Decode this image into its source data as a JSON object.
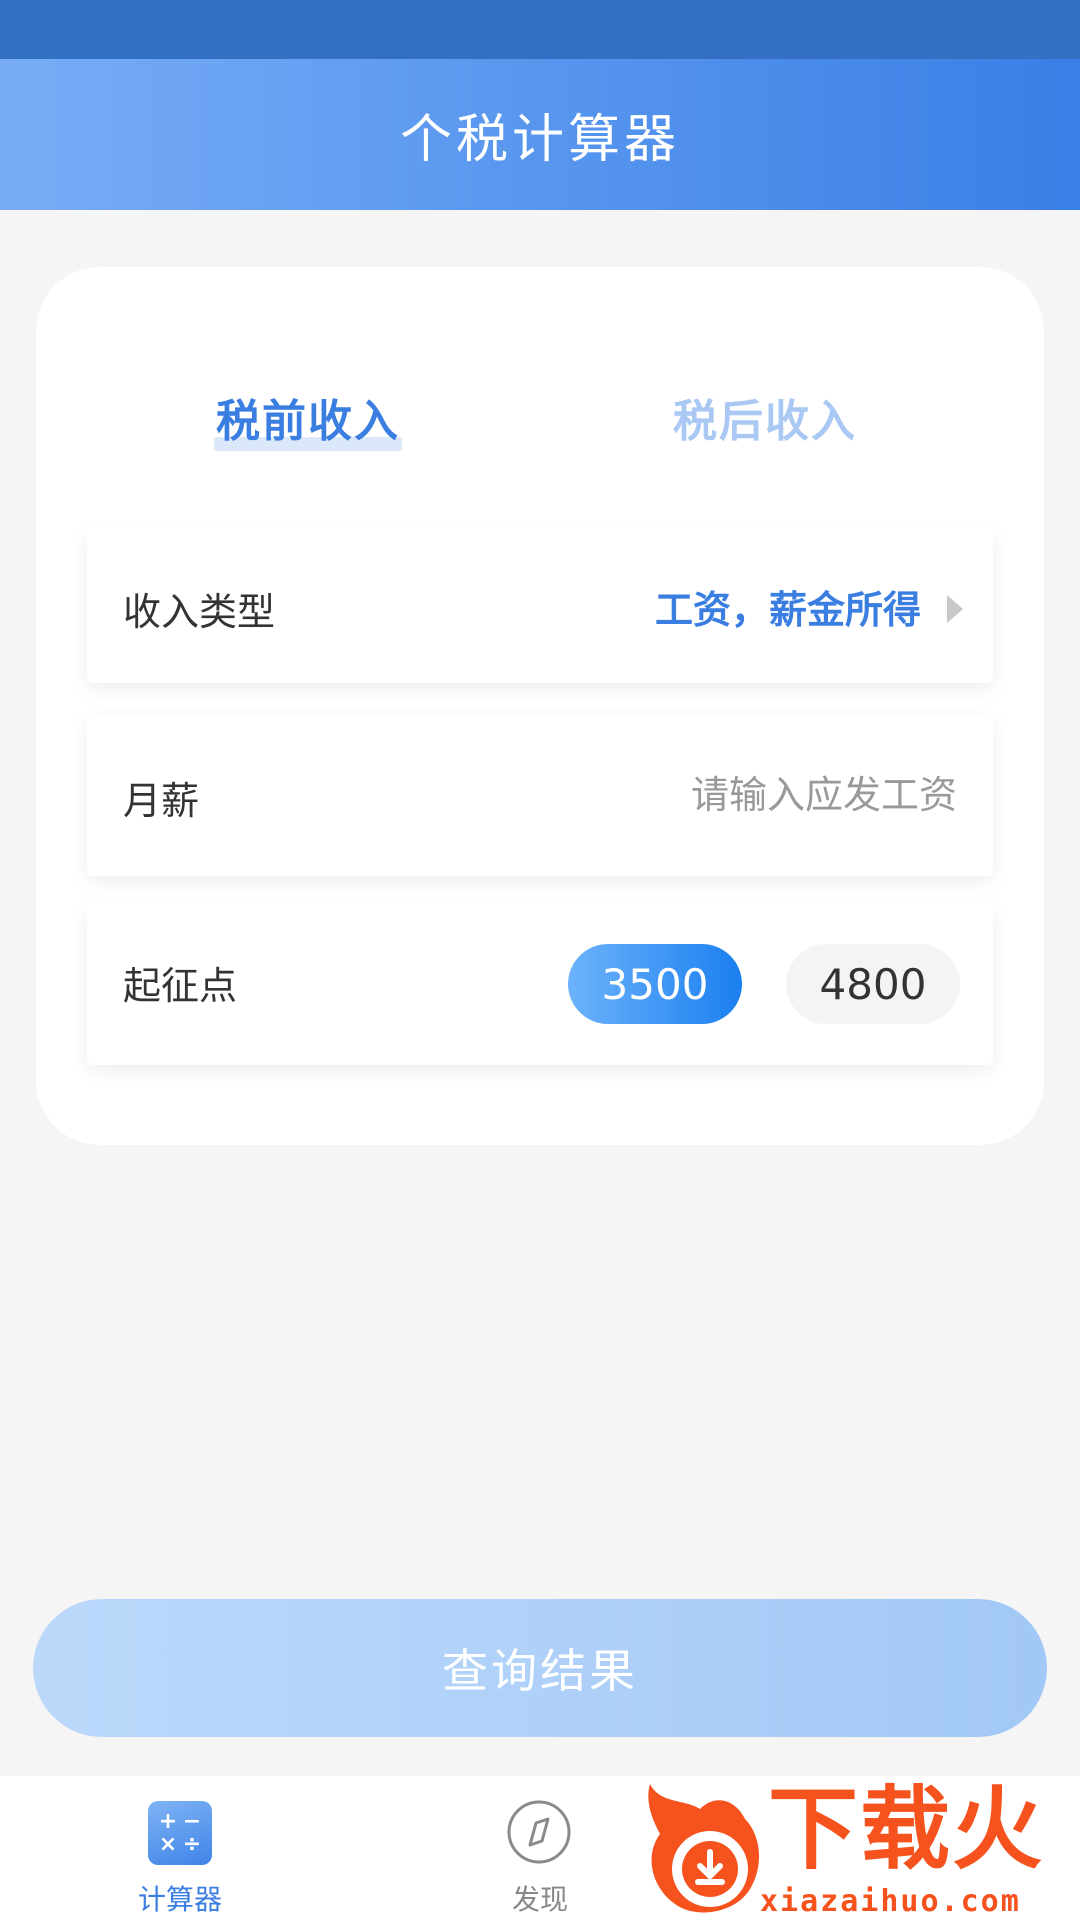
{
  "header": {
    "title": "个税计算器"
  },
  "tabs": {
    "pre_tax": "税前收入",
    "post_tax": "税后收入"
  },
  "form": {
    "income_type_label": "收入类型",
    "income_type_value": "工资，薪金所得",
    "salary_label": "月薪",
    "salary_placeholder": "请输入应发工资",
    "salary_value": "",
    "threshold_label": "起征点",
    "threshold_options": [
      "3500",
      "4800"
    ],
    "threshold_selected": "3500"
  },
  "query_button": {
    "label": "查询结果"
  },
  "bottom_nav": {
    "items": [
      {
        "label": "计算器",
        "icon": "calculator-icon",
        "active": true
      },
      {
        "label": "发现",
        "icon": "compass-icon",
        "active": false
      }
    ]
  },
  "watermark": {
    "name": "下载火",
    "site": "xiazaihuo.com"
  },
  "colors": {
    "accent": "#3a7ee1",
    "status_bar": "#3370c4",
    "inactive_tab": "#a9c8f3",
    "watermark": "#f5521d"
  }
}
